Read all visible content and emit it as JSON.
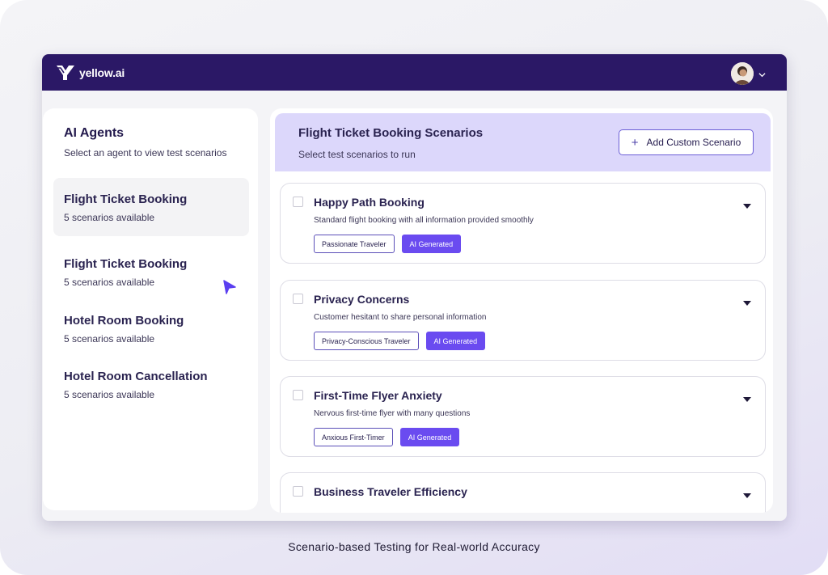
{
  "app": {
    "name": "yellow.ai"
  },
  "sidebar": {
    "title": "AI Agents",
    "subtitle": "Select an agent to view test scenarios",
    "agents": [
      {
        "name": "Flight Ticket Booking",
        "count": "5 scenarios available",
        "active": true
      },
      {
        "name": "Flight Ticket Booking",
        "count": "5 scenarios available",
        "active": false
      },
      {
        "name": "Hotel Room Booking",
        "count": "5 scenarios available",
        "active": false
      },
      {
        "name": "Hotel Room Cancellation",
        "count": "5 scenarios available",
        "active": false
      }
    ]
  },
  "main": {
    "title": "Flight Ticket Booking Scenarios",
    "subtitle": "Select test scenarios to run",
    "add_button": "Add Custom Scenario",
    "scenarios": [
      {
        "title": "Happy Path Booking",
        "description": "Standard flight booking with all information provided smoothly",
        "persona": "Passionate Traveler",
        "badge": "AI Generated"
      },
      {
        "title": "Privacy Concerns",
        "description": "Customer hesitant to share personal information",
        "persona": "Privacy-Conscious Traveler",
        "badge": "AI Generated"
      },
      {
        "title": "First-Time Flyer Anxiety",
        "description": "Nervous first-time flyer with many questions",
        "persona": "Anxious First-Timer",
        "badge": "AI Generated"
      },
      {
        "title": "Business Traveler Efficiency"
      }
    ]
  },
  "caption": "Scenario-based Testing for Real-world Accuracy",
  "colors": {
    "topbar": "#2b1866",
    "header_band": "#dcd7fb",
    "ai_badge": "#6a4bf0",
    "cursor": "#5b3ff0"
  },
  "icons": [
    "yellow-ai-logo-icon",
    "user-avatar-icon",
    "chevron-down-icon",
    "plus-icon",
    "caret-down-icon",
    "pointer-cursor-icon"
  ]
}
